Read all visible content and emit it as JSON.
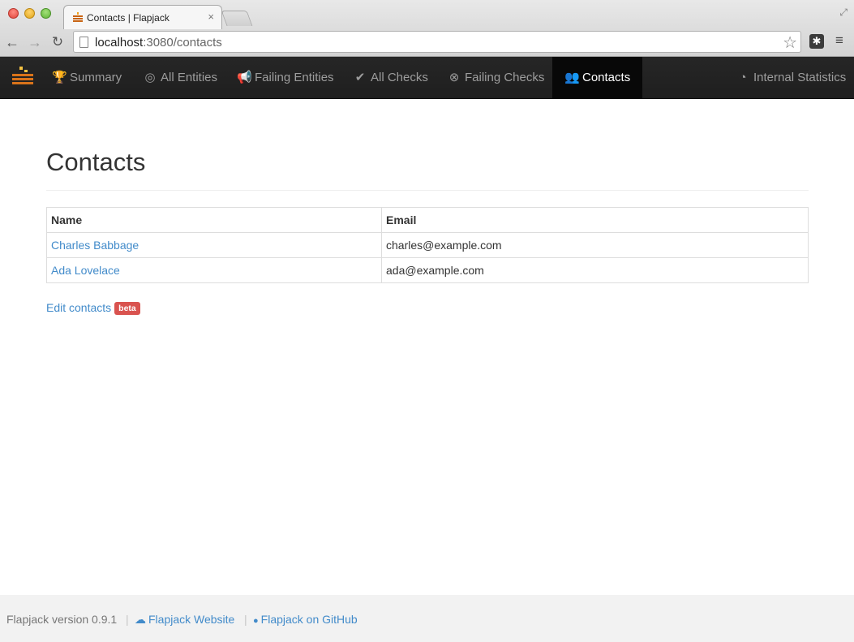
{
  "browser": {
    "tab_title": "Contacts | Flapjack",
    "tab_close": "×",
    "url_host": "localhost",
    "url_rest": ":3080/contacts",
    "back_glyph": "←",
    "forward_glyph": "→",
    "reload_glyph": "↻",
    "star_glyph": "☆",
    "menu_glyph": "≡",
    "resize_glyph": "⤢",
    "extension_glyph": "✱"
  },
  "navbar": {
    "items": [
      {
        "label": "Summary",
        "icon": "trophy-icon",
        "glyph": "🏆"
      },
      {
        "label": "All Entities",
        "icon": "target-icon",
        "glyph": "◎"
      },
      {
        "label": "Failing Entities",
        "icon": "bullhorn-icon",
        "glyph": "📢"
      },
      {
        "label": "All Checks",
        "icon": "check-circle-icon",
        "glyph": "✔"
      },
      {
        "label": "Failing Checks",
        "icon": "x-circle-icon",
        "glyph": "⊗"
      },
      {
        "label": "Contacts",
        "icon": "group-icon",
        "glyph": "👥",
        "active": true
      },
      {
        "label": "Internal Statistics",
        "icon": "dashboard-icon",
        "glyph": "◔"
      }
    ]
  },
  "page": {
    "title": "Contacts",
    "table": {
      "headers": [
        "Name",
        "Email"
      ],
      "rows": [
        {
          "name": "Charles Babbage",
          "email": "charles@example.com"
        },
        {
          "name": "Ada Lovelace",
          "email": "ada@example.com"
        }
      ]
    },
    "edit_link": "Edit contacts",
    "beta_badge": "beta"
  },
  "footer": {
    "version_text": "Flapjack version 0.9.1",
    "website_link": "Flapjack Website",
    "github_link": "Flapjack on GitHub",
    "separator": "|",
    "cloud_glyph": "☁",
    "github_glyph": "●"
  },
  "colors": {
    "link": "#428bca",
    "navbar_bg": "#222222",
    "navbar_active_bg": "#080808",
    "badge": "#d9534f",
    "footer_bg": "#f2f2f2"
  }
}
